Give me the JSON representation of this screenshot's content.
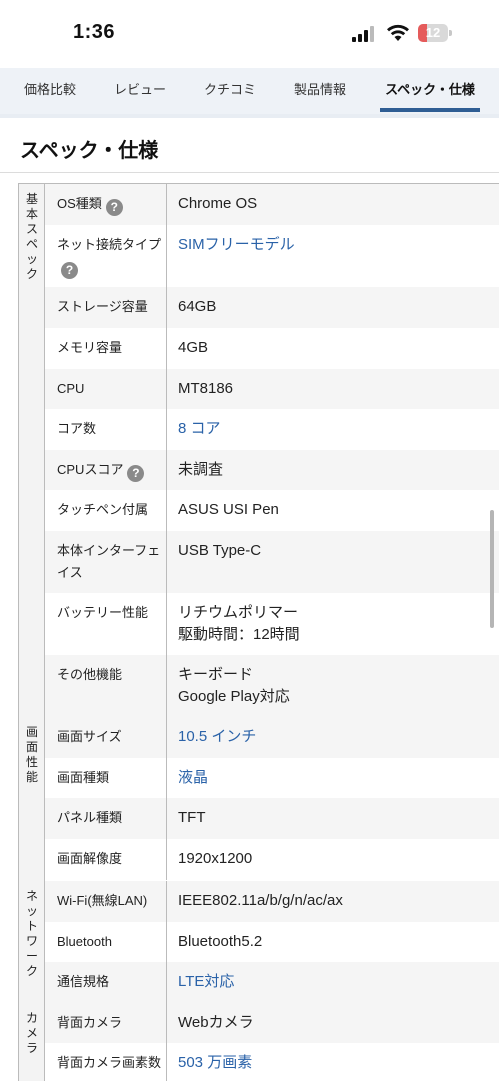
{
  "status": {
    "time": "1:36",
    "battery": "12"
  },
  "tabs": [
    "価格比較",
    "レビュー",
    "クチコミ",
    "製品情報",
    "スペック・仕様"
  ],
  "heading": "スペック・仕様",
  "groups": [
    {
      "label": "基本スペック",
      "rows": [
        {
          "key": "OS種類",
          "help": "?",
          "value": "Chrome OS"
        },
        {
          "key": "ネット接続タイプ",
          "help": "?",
          "value": "SIMフリーモデル",
          "link": true
        },
        {
          "key": "ストレージ容量",
          "value": "64GB"
        },
        {
          "key": "メモリ容量",
          "value": "4GB"
        },
        {
          "key": "CPU",
          "value": "MT8186"
        },
        {
          "key": "コア数",
          "value": "8 コア",
          "link": true
        },
        {
          "key": "CPUスコア",
          "help": "?",
          "value": "未調査"
        },
        {
          "key": "タッチペン付属",
          "value": "ASUS USI Pen"
        },
        {
          "key": "本体インターフェイス",
          "value": "USB Type-C"
        },
        {
          "key": "バッテリー性能",
          "value": "リチウムポリマー",
          "value2": "駆動時間：12時間"
        },
        {
          "key": "その他機能",
          "value": "キーボード",
          "value2": "Google Play対応"
        }
      ]
    },
    {
      "label": "画面性能",
      "rows": [
        {
          "key": "画面サイズ",
          "value": "10.5 インチ",
          "link": true
        },
        {
          "key": "画面種類",
          "value": "液晶",
          "link": true
        },
        {
          "key": "パネル種類",
          "value": "TFT"
        },
        {
          "key": "画面解像度",
          "value": "1920x1200"
        }
      ]
    },
    {
      "label": "ネットワーク",
      "rows": [
        {
          "key": "Wi-Fi(無線LAN)",
          "value": "IEEE802.11a/b/g/n/ac/ax"
        },
        {
          "key": "Bluetooth",
          "value": "Bluetooth5.2"
        },
        {
          "key": "通信規格",
          "value": "LTE対応",
          "link": true
        }
      ]
    },
    {
      "label": "カメラ",
      "rows": [
        {
          "key": "背面カメラ",
          "value": "Webカメラ"
        },
        {
          "key": "背面カメラ画素数",
          "value": "503 万画素",
          "link": true
        }
      ]
    }
  ]
}
